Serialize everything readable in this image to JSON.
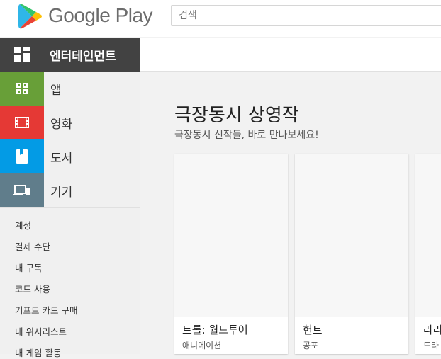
{
  "header": {
    "logo_text": "Google Play",
    "search_placeholder": "검색"
  },
  "sidebar": {
    "section_title": "엔터테인먼트",
    "categories": [
      {
        "label": "앱",
        "icon": "apps-grid-icon",
        "color": "#689f38"
      },
      {
        "label": "영화",
        "icon": "film-icon",
        "color": "#e53935"
      },
      {
        "label": "도서",
        "icon": "book-icon",
        "color": "#039be5"
      },
      {
        "label": "기기",
        "icon": "devices-icon",
        "color": "#607d8b"
      }
    ],
    "account_items": [
      {
        "label": "계정"
      },
      {
        "label": "결제 수단"
      },
      {
        "label": "내 구독"
      },
      {
        "label": "코드 사용"
      },
      {
        "label": "기프트 카드 구매"
      },
      {
        "label": "내 위시리스트"
      },
      {
        "label": "내 게임 활동"
      }
    ]
  },
  "main": {
    "title": "극장동시 상영작",
    "subtitle": "극장동시 신작들, 바로 만나보세요!",
    "cards": [
      {
        "title": "트롤: 월드투어",
        "genre": "애니메이션"
      },
      {
        "title": "헌트",
        "genre": "공포"
      },
      {
        "title": "라라",
        "genre": "드라"
      }
    ]
  }
}
